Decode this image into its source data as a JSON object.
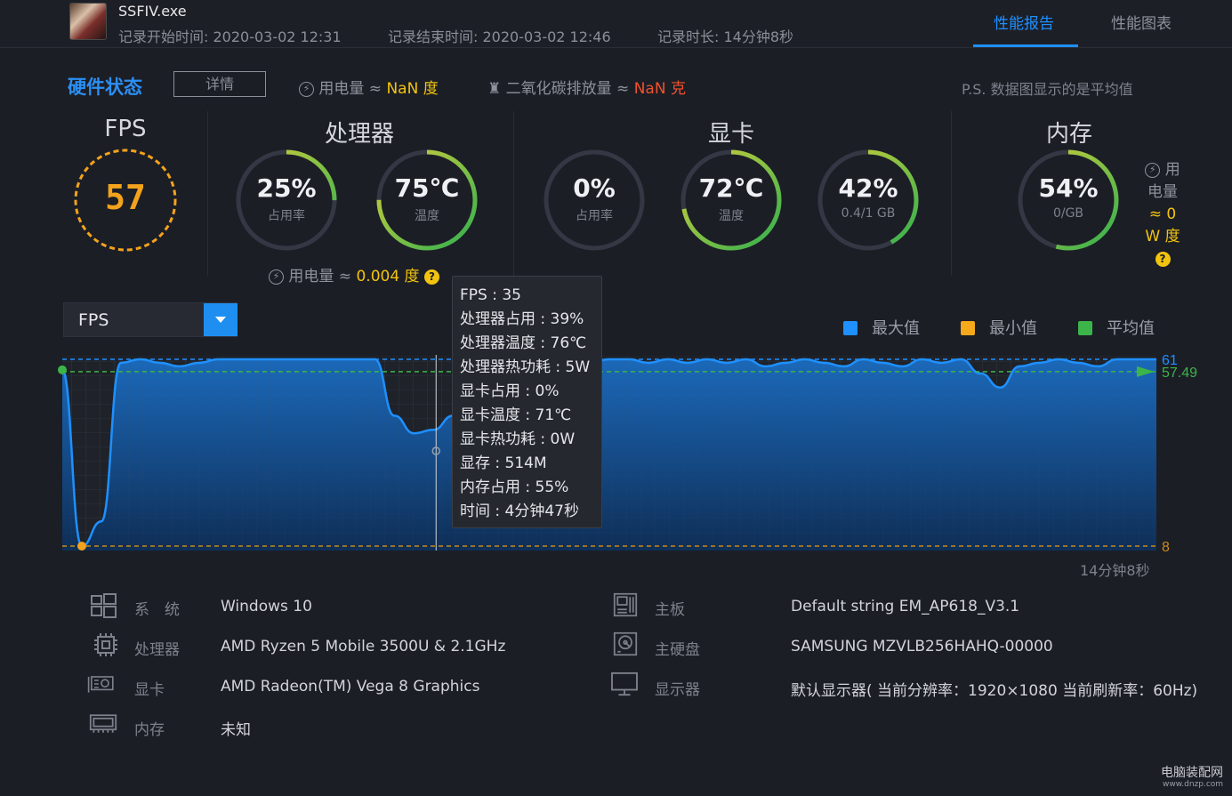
{
  "header": {
    "app_name": "SSFIV.exe",
    "record_start": "记录开始时间: 2020-03-02 12:31",
    "record_end": "记录结束时间: 2020-03-02 12:46",
    "record_duration": "记录时长: 14分钟8秒",
    "tabs": [
      {
        "label": "性能报告",
        "active": true
      },
      {
        "label": "性能图表",
        "active": false
      }
    ]
  },
  "hardware": {
    "title": "硬件状态",
    "details_button": "详情",
    "power_label": "用电量 ≈",
    "power_value": "NaN 度",
    "co2_label": "二氧化碳排放量 ≈",
    "co2_value": "NaN 克",
    "note": "P.S. 数据图显示的是平均值"
  },
  "fps": {
    "title": "FPS",
    "value": "57"
  },
  "cpu": {
    "title": "处理器",
    "usage": {
      "value": "25%",
      "label": "占用率",
      "percent": 25
    },
    "temp": {
      "value": "75℃",
      "label": "温度",
      "percent": 75
    },
    "power_label": "用电量 ≈",
    "power_value": "0.004 度"
  },
  "gpu": {
    "title": "显卡",
    "usage": {
      "value": "0%",
      "label": "占用率",
      "percent": 0
    },
    "temp": {
      "value": "72℃",
      "label": "温度",
      "percent": 72
    },
    "vram": {
      "value": "42%",
      "label": "0.4/1 GB",
      "percent": 42
    }
  },
  "memory": {
    "title": "内存",
    "usage": {
      "value": "54%",
      "label": "0/GB",
      "percent": 54
    },
    "power_lines": [
      "用",
      "电量",
      "≈ 0",
      "W 度"
    ]
  },
  "chart": {
    "metric": "FPS",
    "legend": [
      {
        "label": "最大值",
        "color": "#1e90ff"
      },
      {
        "label": "最小值",
        "color": "#f5a91b"
      },
      {
        "label": "平均值",
        "color": "#3cb449"
      }
    ],
    "max_label": "61",
    "avg_label": "57.49",
    "min_label": "8",
    "end_time": "14分钟8秒"
  },
  "chart_data": {
    "type": "area",
    "title": "",
    "xlabel": "",
    "ylabel": "FPS",
    "ylim": [
      8,
      61
    ],
    "max": 61,
    "min": 8,
    "avg": 57.49,
    "x": [
      0,
      0.25,
      0.5,
      0.75,
      1,
      1.25,
      1.5,
      1.75,
      2,
      2.25,
      2.5,
      2.75,
      3,
      3.25,
      3.5,
      3.75,
      4,
      4.25,
      4.5,
      4.75,
      5,
      5.25,
      5.5,
      5.75,
      6,
      6.25,
      6.5,
      6.75,
      7,
      7.25,
      7.5,
      7.75,
      8,
      8.25,
      8.5,
      8.75,
      9,
      9.25,
      9.5,
      9.75,
      10,
      10.25,
      10.5,
      10.75,
      11,
      11.25,
      11.5,
      11.75,
      12,
      12.25,
      12.5,
      12.75,
      13,
      13.25,
      13.5,
      13.75,
      14
    ],
    "series": [
      {
        "values": [
          58,
          8,
          15,
          60,
          61,
          60,
          59,
          60,
          61,
          61,
          61,
          61,
          61,
          61,
          61,
          61,
          61,
          45,
          40,
          41,
          45,
          35,
          60,
          61,
          61,
          60,
          61,
          60,
          61,
          61,
          60,
          61,
          60,
          61,
          60,
          61,
          59,
          60,
          61,
          60,
          59,
          61,
          60,
          59,
          61,
          60,
          61,
          57,
          53,
          59,
          60,
          61,
          60,
          59,
          61,
          61,
          61
        ]
      }
    ],
    "tooltip": [
      "FPS : 35",
      "处理器占用 : 39%",
      "处理器温度 : 76℃",
      "处理器热功耗 : 5W",
      "显卡占用 : 0%",
      "显卡温度 : 71℃",
      "显卡热功耗 : 0W",
      "显存 : 514M",
      "内存占用 : 55%",
      "时间 : 4分钟47秒"
    ]
  },
  "sysinfo": {
    "left": [
      {
        "label": "系　统",
        "value": "Windows 10",
        "icon": "windows-icon"
      },
      {
        "label": "处理器",
        "value": "AMD Ryzen 5 Mobile 3500U & 2.1GHz",
        "icon": "cpu-icon"
      },
      {
        "label": "显卡",
        "value": "AMD Radeon(TM) Vega 8 Graphics",
        "icon": "gpu-icon"
      },
      {
        "label": "内存",
        "value": "未知",
        "icon": "memory-icon"
      }
    ],
    "right": [
      {
        "label": "主板",
        "value": "Default string EM_AP618_V3.1",
        "icon": "motherboard-icon"
      },
      {
        "label": "主硬盘",
        "value": "SAMSUNG MZVLB256HAHQ-00000",
        "icon": "harddisk-icon"
      },
      {
        "label": "显示器",
        "value": "默认显示器( 当前分辨率：1920×1080 当前刷新率：60Hz)",
        "icon": "monitor-icon"
      }
    ]
  },
  "watermark": {
    "line1": "电脑装配网",
    "line2": "www.dnzp.com"
  }
}
